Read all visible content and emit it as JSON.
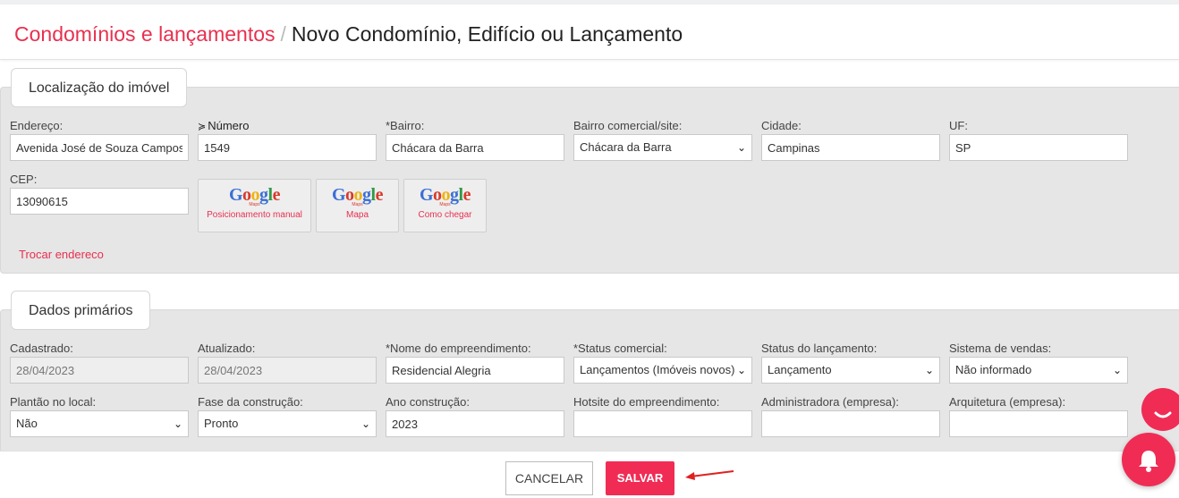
{
  "breadcrumb": {
    "parent": "Condomínios e lançamentos",
    "separator": "/",
    "current": "Novo Condomínio, Edifício ou Lançamento"
  },
  "location_panel": {
    "title": "Localização do imóvel",
    "endereco": {
      "label": "Endereço:",
      "value": "Avenida José de Souza Campos"
    },
    "numero": {
      "label": "Número",
      "value": "1549"
    },
    "bairro": {
      "label": "*Bairro:",
      "value": "Chácara da Barra"
    },
    "bairro_comercial": {
      "label": "Bairro comercial/site:",
      "value": "Chácara da Barra"
    },
    "cidade": {
      "label": "Cidade:",
      "value": "Campinas"
    },
    "uf": {
      "label": "UF:",
      "value": "SP"
    },
    "cep": {
      "label": "CEP:",
      "value": "13090615"
    },
    "google_buttons": [
      {
        "logo": "Google",
        "sub": "Maps",
        "caption": "Posicionamento manual"
      },
      {
        "logo": "Google",
        "sub": "Maps",
        "caption": "Mapa"
      },
      {
        "logo": "Google",
        "sub": "Maps",
        "caption": "Como chegar"
      }
    ],
    "trocar_link": "Trocar endereco"
  },
  "primary_panel": {
    "title": "Dados primários",
    "cadastrado": {
      "label": "Cadastrado:",
      "value": "28/04/2023"
    },
    "atualizado": {
      "label": "Atualizado:",
      "value": "28/04/2023"
    },
    "nome": {
      "label": "*Nome do empreendimento:",
      "value": "Residencial Alegria"
    },
    "status_comercial": {
      "label": "*Status comercial:",
      "value": "Lançamentos (Imóveis novos)"
    },
    "status_lancamento": {
      "label": "Status do lançamento:",
      "value": "Lançamento"
    },
    "sistema_vendas": {
      "label": "Sistema de vendas:",
      "value": "Não informado"
    },
    "plantao": {
      "label": "Plantão no local:",
      "value": "Não"
    },
    "fase": {
      "label": "Fase da construção:",
      "value": "Pronto"
    },
    "ano": {
      "label": "Ano construção:",
      "value": "2023"
    },
    "hotsite": {
      "label": "Hotsite do empreendimento:",
      "value": ""
    },
    "administradora": {
      "label": "Administradora (empresa):",
      "value": ""
    },
    "arquitetura": {
      "label": "Arquitetura (empresa):",
      "value": ""
    }
  },
  "footer": {
    "cancel_label": "CANCELAR",
    "save_label": "SALVAR"
  },
  "colors": {
    "accent": "#f02c55",
    "link": "#e8304f",
    "panel_bg": "#e6e6e6"
  },
  "icons": {
    "chat": "chat-icon",
    "notifications": "bell-icon",
    "arrow": "red-arrow-icon"
  }
}
